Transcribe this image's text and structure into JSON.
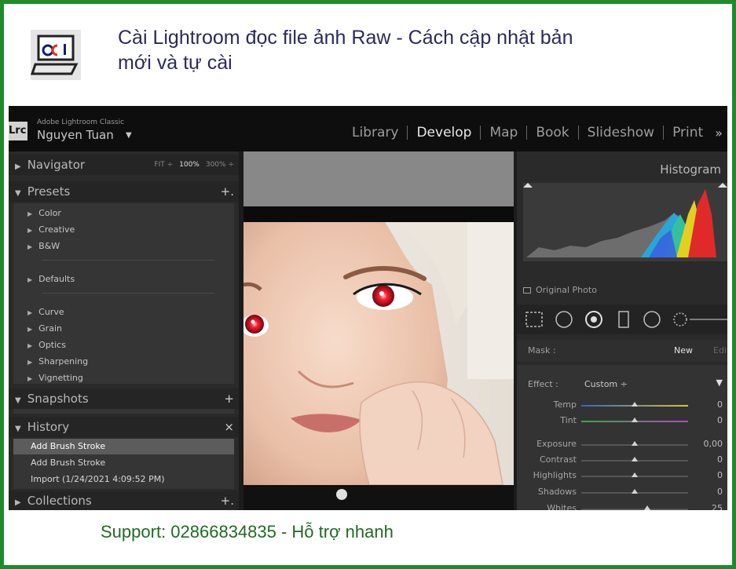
{
  "header": {
    "title": "Cài Lightroom đọc file ảnh Raw - Cách cập nhật bản mới và tự cài",
    "logo_text": "pci"
  },
  "lightroom": {
    "badge": "Lrc",
    "product": "Adobe Lightroom Classic",
    "user": "Nguyen Tuan",
    "user_caret": "▼",
    "modules": [
      {
        "label": "Library",
        "active": false
      },
      {
        "label": "Develop",
        "active": true
      },
      {
        "label": "Map",
        "active": false
      },
      {
        "label": "Book",
        "active": false
      },
      {
        "label": "Slideshow",
        "active": false
      },
      {
        "label": "Print",
        "active": false
      }
    ],
    "modules_more": "»",
    "left": {
      "navigator": {
        "label": "Navigator",
        "fit": "FIT ÷",
        "z1": "100%",
        "z2": "300% ÷"
      },
      "presets": {
        "label": "Presets",
        "add": "+.",
        "items": [
          "Color",
          "Creative",
          "B&W",
          "Defaults",
          "Curve",
          "Grain",
          "Optics",
          "Sharpening",
          "Vignetting"
        ]
      },
      "snapshots": {
        "label": "Snapshots",
        "add": "+"
      },
      "history": {
        "label": "History",
        "clear": "×",
        "items": [
          "Add Brush Stroke",
          "Add Brush Stroke",
          "Import (1/24/2021 4:09:52 PM)"
        ]
      },
      "collections": {
        "label": "Collections",
        "add": "+."
      }
    },
    "right": {
      "histogram_label": "Histogram",
      "original_photo": "Original Photo",
      "mask_label": "Mask :",
      "mask_new": "New",
      "mask_edit": "Edit",
      "effect_label": "Effect :",
      "effect_value": "Custom ÷",
      "effect_caret": "▼",
      "sliders": [
        {
          "label": "Temp",
          "value": "0",
          "pos": 0.5
        },
        {
          "label": "Tint",
          "value": "0",
          "pos": 0.5
        },
        {
          "label": "Exposure",
          "value": "0,00",
          "pos": 0.5
        },
        {
          "label": "Contrast",
          "value": "0",
          "pos": 0.5
        },
        {
          "label": "Highlights",
          "value": "0",
          "pos": 0.5
        },
        {
          "label": "Shadows",
          "value": "0",
          "pos": 0.5
        },
        {
          "label": "Whites",
          "value": "25",
          "pos": 0.62
        }
      ]
    }
  },
  "footer": {
    "support": "Support: 02866834835 - Hỗ trợ nhanh"
  },
  "colors": {
    "border_green": "#1f8a2a",
    "title_color": "#2c2a5c",
    "support_color": "#1f6b21"
  }
}
